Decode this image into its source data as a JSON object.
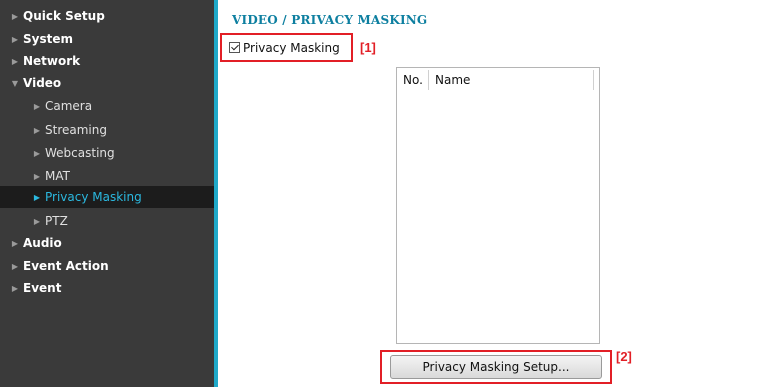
{
  "sidebar": {
    "items": [
      {
        "label": "Quick Setup",
        "arrow": "▶"
      },
      {
        "label": "System",
        "arrow": "▶"
      },
      {
        "label": "Network",
        "arrow": "▶"
      },
      {
        "label": "Video",
        "arrow": "▼"
      },
      {
        "label": "Camera",
        "arrow": "▶"
      },
      {
        "label": "Streaming",
        "arrow": "▶"
      },
      {
        "label": "Webcasting",
        "arrow": "▶"
      },
      {
        "label": "MAT",
        "arrow": "▶"
      },
      {
        "label": "Privacy Masking",
        "arrow": "▶"
      },
      {
        "label": "PTZ",
        "arrow": "▶"
      },
      {
        "label": "Audio",
        "arrow": "▶"
      },
      {
        "label": "Event Action",
        "arrow": "▶"
      },
      {
        "label": "Event",
        "arrow": "▶"
      }
    ],
    "active_item": "Privacy Masking"
  },
  "main": {
    "title": "VIDEO / PRIVACY MASKING",
    "privacy_checkbox": {
      "label": "Privacy Masking",
      "checked": true
    },
    "list": {
      "col_no": "No.",
      "col_name": "Name",
      "rows": []
    },
    "setup_button_label": "Privacy Masking Setup..."
  },
  "annotations": {
    "one": "[1]",
    "two": "[2]"
  },
  "colors": {
    "sidebar_bg": "#3a3a3a",
    "accent": "#1fa9c9",
    "active_text": "#2bb8df",
    "annotation_red": "#e21f26",
    "title": "#0d7fa0"
  }
}
